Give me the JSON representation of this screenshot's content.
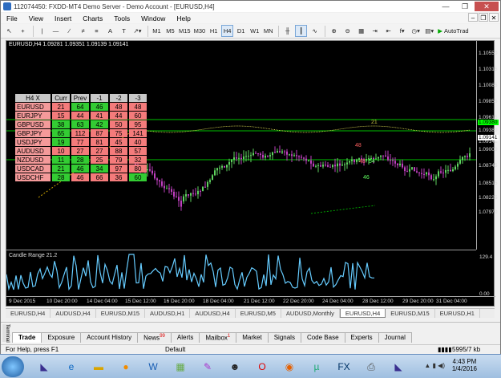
{
  "window": {
    "title": "112074450: FXDD-MT4 Demo Server - Demo Account - [EURUSD,H4]",
    "buttons": [
      "—",
      "❐",
      "✕"
    ]
  },
  "menu": [
    "File",
    "View",
    "Insert",
    "Charts",
    "Tools",
    "Window",
    "Help"
  ],
  "toolbar": {
    "timeframes": [
      "M1",
      "M5",
      "M15",
      "M30",
      "H1",
      "H4",
      "D1",
      "W1",
      "MN"
    ],
    "active_timeframe": "H4",
    "autotrade_label": "AutoTrad"
  },
  "chart": {
    "header": "EURUSD,H4  1.09281 1.09351 1.09139 1.09141",
    "price_labels": [
      "1.10550",
      "1.10315",
      "1.10085",
      "1.09855",
      "1.09615",
      "1.09380",
      "1.09141",
      "1.09000",
      "1.08745",
      "1.08515",
      "1.08225",
      "1.07970"
    ],
    "current_price": "1.09141",
    "green_price": "1.09380",
    "indicator_label": "Candle Range 21.2",
    "indicator_scale": [
      "129.4",
      "0.00"
    ],
    "time_labels": [
      "9 Dec 2015",
      "10 Dec 20:00",
      "14 Dec 04:00",
      "15 Dec 12:00",
      "16 Dec 20:00",
      "18 Dec 04:00",
      "21 Dec 12:00",
      "22 Dec 20:00",
      "24 Dec 04:00",
      "28 Dec 12:00",
      "29 Dec 20:00",
      "31 Dec 04:00"
    ],
    "candle_numbers": [
      "21",
      "48",
      "48",
      "54",
      "46"
    ]
  },
  "matrix": {
    "headers": [
      "H4  X",
      "Curr",
      "Prev",
      "-1",
      "-2",
      "-3"
    ],
    "rows": [
      {
        "pair": "EURUSD",
        "values": [
          "21",
          "64",
          "46",
          "48",
          "48"
        ],
        "colors": [
          "r",
          "g",
          "g",
          "r",
          "r"
        ]
      },
      {
        "pair": "EURJPY",
        "values": [
          "15",
          "44",
          "41",
          "44",
          "60"
        ],
        "colors": [
          "r",
          "r",
          "r",
          "r",
          "r"
        ]
      },
      {
        "pair": "GBPUSD",
        "values": [
          "38",
          "63",
          "42",
          "50",
          "95"
        ],
        "colors": [
          "g",
          "g",
          "g",
          "r",
          "r"
        ]
      },
      {
        "pair": "GBPJPY",
        "values": [
          "65",
          "112",
          "87",
          "75",
          "141"
        ],
        "colors": [
          "g",
          "r",
          "r",
          "r",
          "r"
        ]
      },
      {
        "pair": "USDJPY",
        "values": [
          "19",
          "77",
          "81",
          "45",
          "40"
        ],
        "colors": [
          "g",
          "r",
          "r",
          "r",
          "r"
        ]
      },
      {
        "pair": "AUDUSD",
        "values": [
          "10",
          "27",
          "27",
          "88",
          "57"
        ],
        "colors": [
          "r",
          "r",
          "r",
          "r",
          "r"
        ]
      },
      {
        "pair": "NZDUSD",
        "values": [
          "11",
          "28",
          "25",
          "79",
          "32"
        ],
        "colors": [
          "g",
          "g",
          "r",
          "r",
          "r"
        ]
      },
      {
        "pair": "USDCAD",
        "values": [
          "21",
          "46",
          "34",
          "97",
          "80"
        ],
        "colors": [
          "g",
          "g",
          "g",
          "r",
          "r"
        ]
      },
      {
        "pair": "USDCHF",
        "values": [
          "28",
          "46",
          "66",
          "36",
          "60"
        ],
        "colors": [
          "g",
          "r",
          "r",
          "r",
          "g"
        ]
      }
    ]
  },
  "chart_tabs": [
    "EURUSD,H4",
    "AUDUSD,H4",
    "EURUSD,M15",
    "AUDUSD,H1",
    "AUDUSD,H4",
    "EURUSD,M5",
    "AUDUSD,Monthly",
    "EURUSD,H4",
    "EURUSD,M15",
    "EURUSD,H1"
  ],
  "active_chart_tab": 7,
  "terminal_tabs": [
    {
      "label": "Trade",
      "badge": ""
    },
    {
      "label": "Exposure",
      "badge": ""
    },
    {
      "label": "Account History",
      "badge": ""
    },
    {
      "label": "News",
      "badge": "99"
    },
    {
      "label": "Alerts",
      "badge": ""
    },
    {
      "label": "Mailbox",
      "badge": "1"
    },
    {
      "label": "Market",
      "badge": ""
    },
    {
      "label": "Signals",
      "badge": ""
    },
    {
      "label": "Code Base",
      "badge": ""
    },
    {
      "label": "Experts",
      "badge": ""
    },
    {
      "label": "Journal",
      "badge": ""
    }
  ],
  "terminal_side_label": "Terminal",
  "status": {
    "help": "For Help, press F1",
    "profile": "Default",
    "traffic": "5995/7 kb"
  },
  "taskbar": {
    "time": "4:43 PM",
    "date": "1/4/2016"
  }
}
